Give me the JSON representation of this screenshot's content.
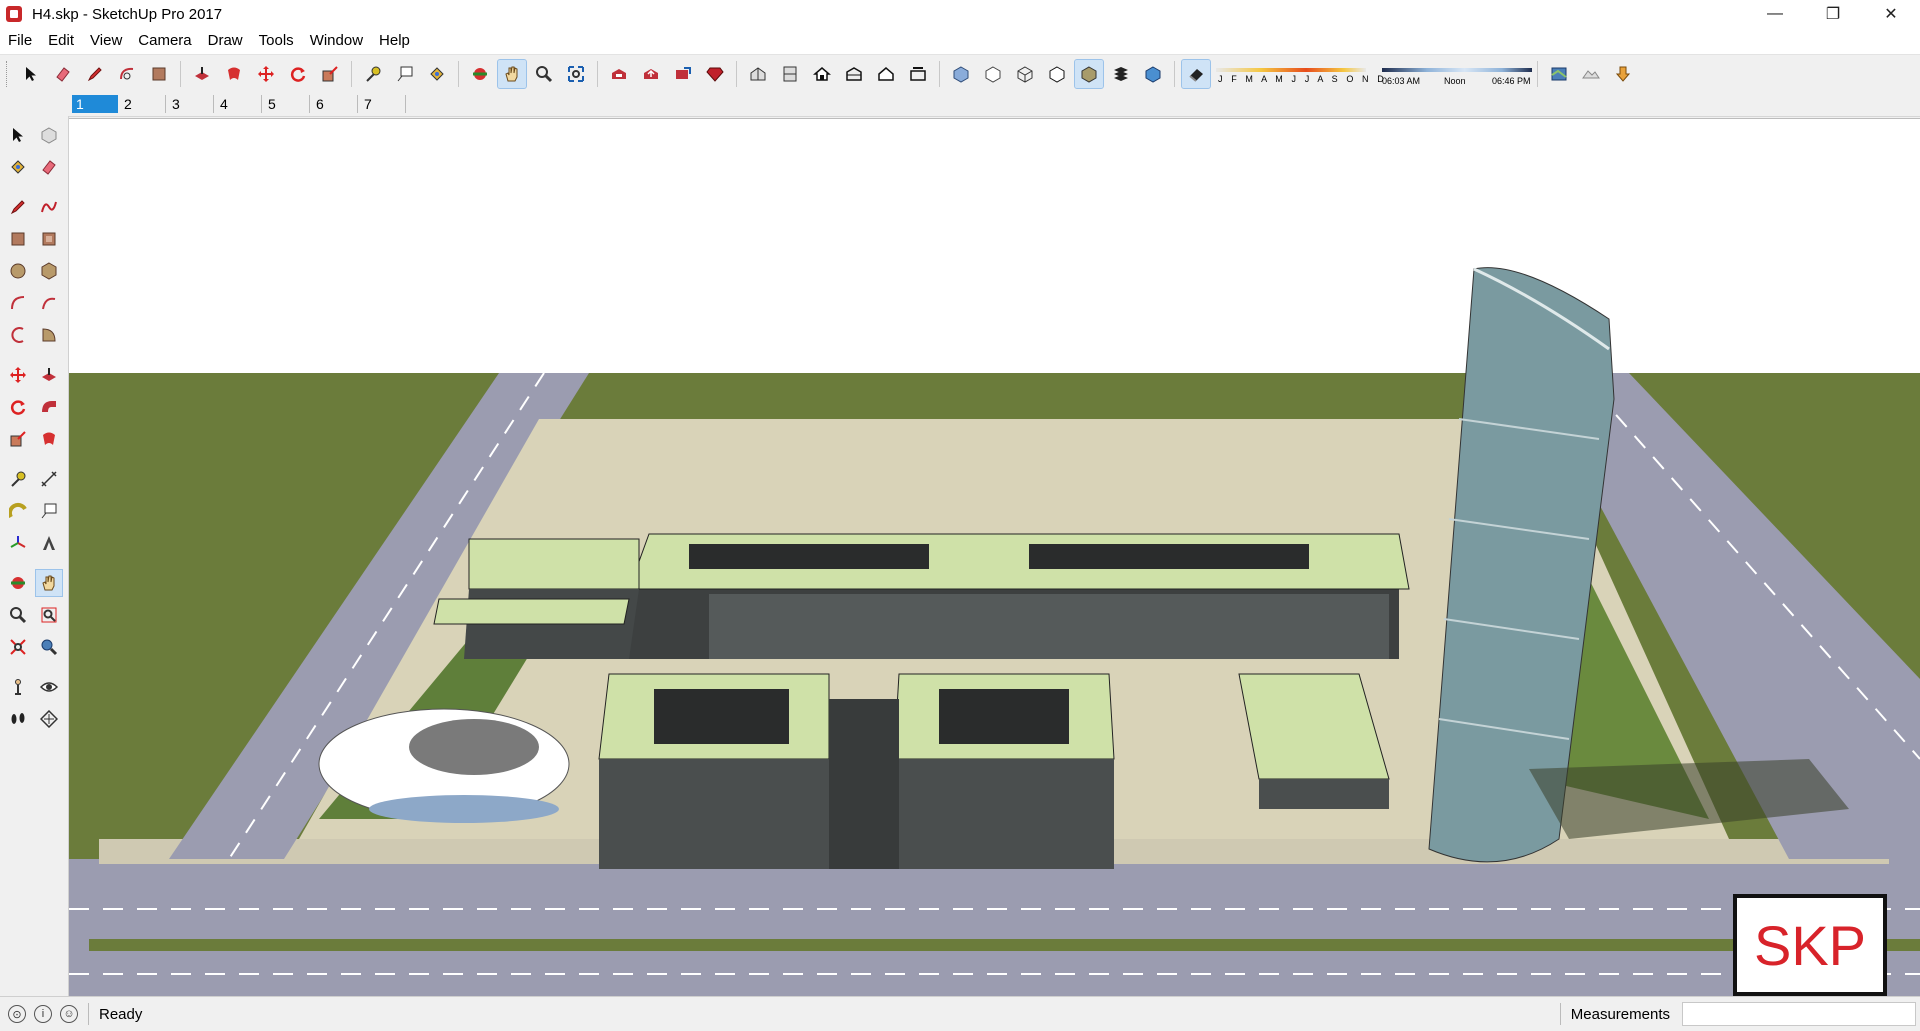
{
  "window": {
    "title": "H4.skp - SketchUp Pro 2017",
    "controls": {
      "minimize": "—",
      "restore": "❐",
      "close": "✕"
    }
  },
  "menu": [
    "File",
    "Edit",
    "View",
    "Camera",
    "Draw",
    "Tools",
    "Window",
    "Help"
  ],
  "shadows": {
    "months": "J F M A M J J A S O N D",
    "time_start": "06:03 AM",
    "time_mid": "Noon",
    "time_end": "06:46 PM"
  },
  "scenes": [
    {
      "label": "1",
      "active": true
    },
    {
      "label": "2",
      "active": false
    },
    {
      "label": "3",
      "active": false
    },
    {
      "label": "4",
      "active": false
    },
    {
      "label": "5",
      "active": false
    },
    {
      "label": "6",
      "active": false
    },
    {
      "label": "7",
      "active": false
    }
  ],
  "watermark": "SKP",
  "status": {
    "text": "Ready",
    "measurements_label": "Measurements",
    "measurements_value": ""
  },
  "colors": {
    "accent": "#1f8ad8",
    "ground": "#6b7c3b",
    "roof": "#cfe1a8",
    "road": "#9899ad",
    "watermark_red": "#d8232a"
  }
}
